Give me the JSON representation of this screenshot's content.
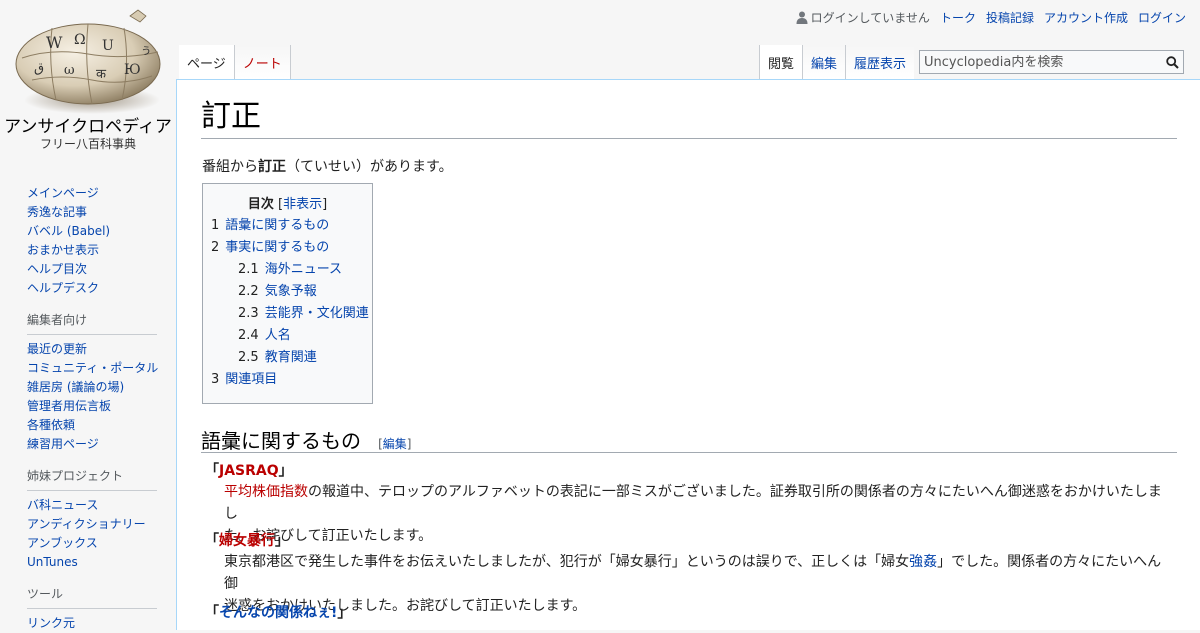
{
  "logo": {
    "title": "アンサイクロペディア",
    "subtitle": "フリー八百科事典"
  },
  "personal": {
    "not_logged_in": "ログインしていません",
    "talk": "トーク",
    "contributions": "投稿記録",
    "create_account": "アカウント作成",
    "login": "ログイン"
  },
  "tabs_left": {
    "page": "ページ",
    "note": "ノート"
  },
  "tabs_right": {
    "read": "閲覧",
    "edit": "編集",
    "history": "履歴表示"
  },
  "search": {
    "placeholder": "Uncyclopedia内を検索"
  },
  "sidebar": {
    "navigation": [
      "メインページ",
      "秀逸な記事",
      "バベル (Babel)",
      "おまかせ表示",
      "ヘルプ目次",
      "ヘルプデスク"
    ],
    "editors": {
      "heading": "編集者向け",
      "items": [
        "最近の更新",
        "コミュニティ・ポータル",
        "雑居房 (議論の場)",
        "管理者用伝言板",
        "各種依頼",
        "練習用ページ"
      ]
    },
    "sister": {
      "heading": "姉妹プロジェクト",
      "items": [
        "バ科ニュース",
        "アンディクショナリー",
        "アンブックス",
        "UnTunes"
      ]
    },
    "tools": {
      "heading": "ツール",
      "items": [
        "リンク元"
      ]
    }
  },
  "article": {
    "title": "訂正",
    "intro": {
      "before": "番組から",
      "bold": "訂正",
      "after": "（ていせい）があります。"
    },
    "toc": {
      "title": "目次",
      "toggle_open": "[",
      "toggle_label": "非表示",
      "toggle_close": "]",
      "items": [
        {
          "num": "1",
          "text": "語彙に関するもの",
          "level": 1
        },
        {
          "num": "2",
          "text": "事実に関するもの",
          "level": 1
        },
        {
          "num": "2.1",
          "text": "海外ニュース",
          "level": 2
        },
        {
          "num": "2.2",
          "text": "気象予報",
          "level": 2
        },
        {
          "num": "2.3",
          "text": "芸能界・文化関連",
          "level": 2
        },
        {
          "num": "2.4",
          "text": "人名",
          "level": 2
        },
        {
          "num": "2.5",
          "text": "教育関連",
          "level": 2
        },
        {
          "num": "3",
          "text": "関連項目",
          "level": 1
        }
      ]
    },
    "section1": {
      "heading": "語彙に関するもの",
      "edit_open": "[",
      "edit_label": "編集",
      "edit_close": "]"
    },
    "entries": [
      {
        "q_open": "「",
        "term": "JASRAQ",
        "q_close": "」",
        "link": "平均株価指数",
        "line1_rest": "の報道中、テロップのアルファベットの表記に一部ミスがございました。証券取引所の関係者の方々にたいへん御迷惑をおかけいたしまし",
        "line2": "た。お詫びして訂正いたします。"
      },
      {
        "q_open": "「",
        "term": "婦女暴行",
        "q_close": "」",
        "line1_a": "東京都港区で発生した事件をお伝えいたしましたが、犯行が「婦女暴行」というのは誤りで、正しくは「婦女",
        "line1_link": "強姦",
        "line1_b": "」でした。関係者の方々にたいへん御",
        "line2": "迷惑をおかけいたしました。お詫びして訂正いたします。"
      },
      {
        "q_open": "「",
        "term": "そんなの関係ねぇ!",
        "q_close": "」"
      }
    ]
  }
}
